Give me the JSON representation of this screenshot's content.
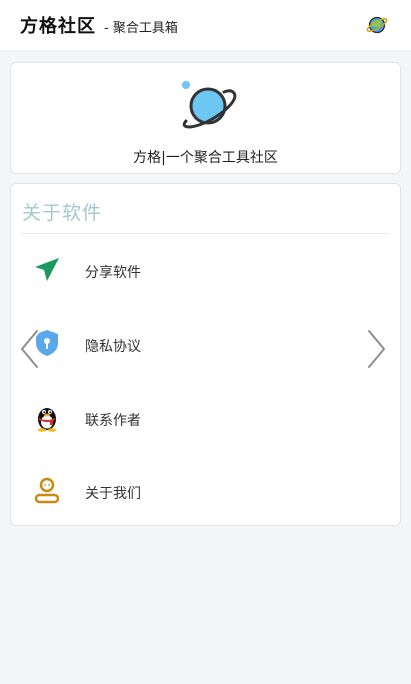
{
  "header": {
    "title": "方格社区",
    "subtitle": "- 聚合工具箱",
    "planet_icon": "planet-icon"
  },
  "hero": {
    "icon": "planet-icon",
    "slogan": "方格|一个聚合工具社区",
    "accent": "#6cc7f2"
  },
  "about": {
    "title": "关于软件",
    "title_color": "#a6c8cd",
    "items": [
      {
        "label": "分享软件",
        "icon": "send-icon"
      },
      {
        "label": "隐私协议",
        "icon": "shield-icon"
      },
      {
        "label": "联系作者",
        "icon": "qq-penguin-icon"
      },
      {
        "label": "关于我们",
        "icon": "user-icon"
      }
    ]
  },
  "nav": {
    "prev_icon": "chevron-left-icon",
    "next_icon": "chevron-right-icon"
  },
  "colors": {
    "send": "#1a9a5e",
    "shield": "#5aa7ea",
    "user": "#c98a10"
  }
}
